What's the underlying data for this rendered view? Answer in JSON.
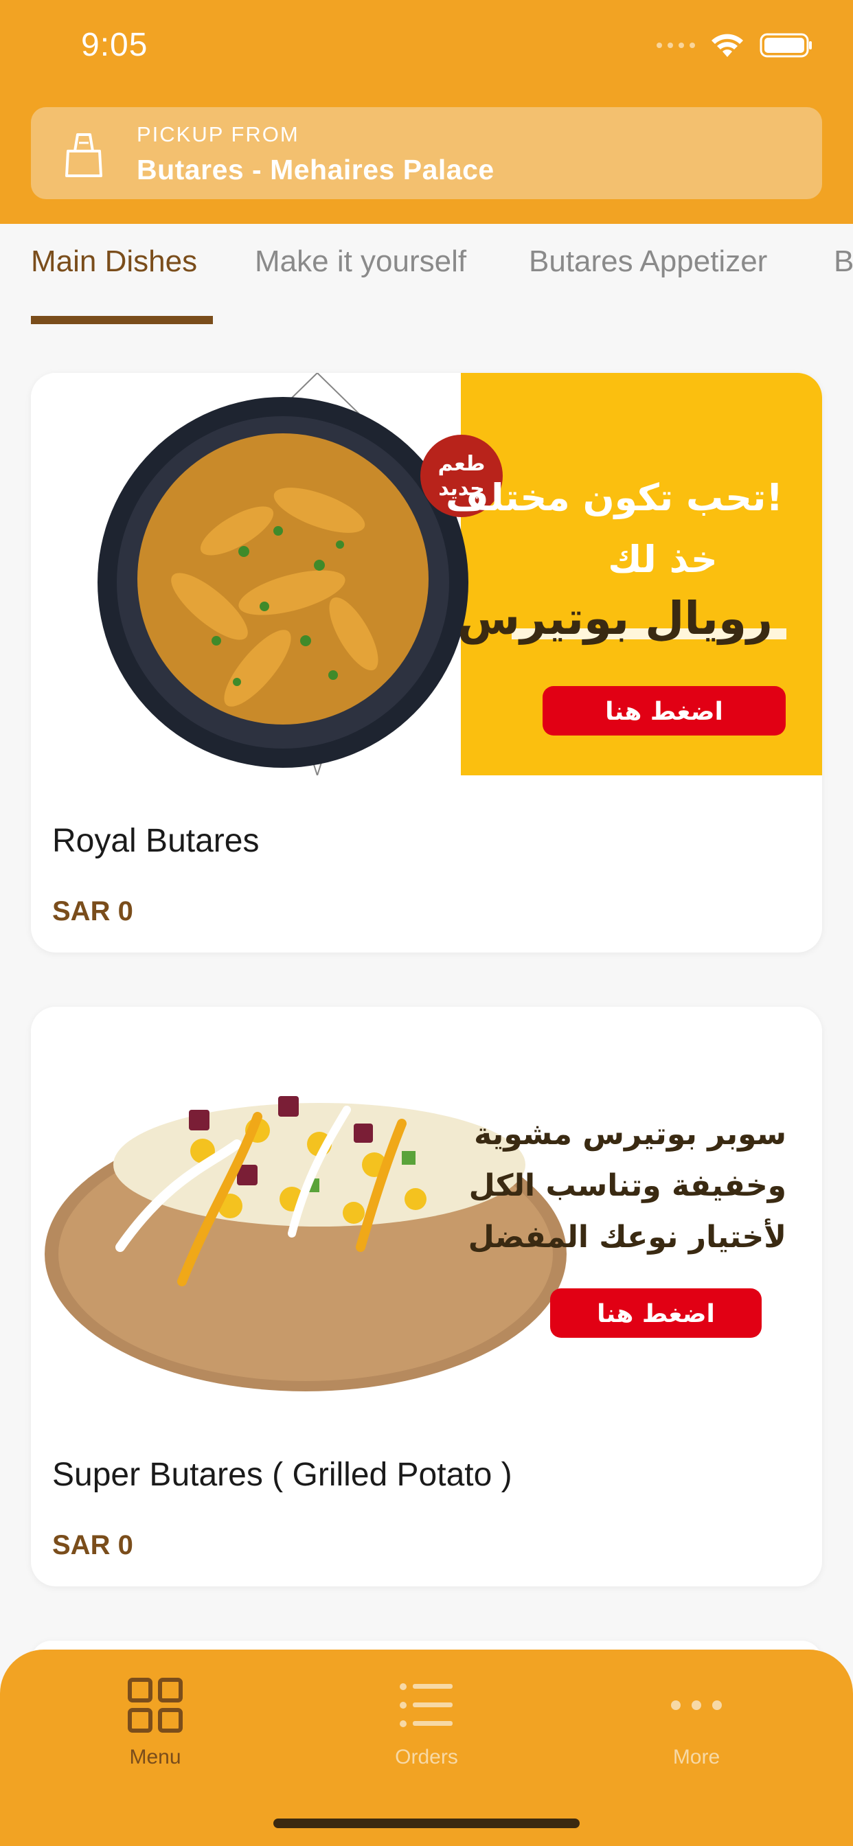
{
  "status_bar": {
    "time": "9:05"
  },
  "pickup": {
    "label": "PICKUP FROM",
    "location": "Butares - Mehaires Palace",
    "icon": "shopping-bag-icon"
  },
  "tabs": [
    {
      "label": "Main Dishes",
      "active": true
    },
    {
      "label": "Make it yourself",
      "active": false
    },
    {
      "label": "Butares Appetizer",
      "active": false
    },
    {
      "label": "B",
      "active": false
    }
  ],
  "products": [
    {
      "name": "Royal Butares",
      "price": "SAR 0",
      "promo": {
        "badge": "طعم جديد",
        "lines": [
          "تحب تكون مختلف!",
          "خذ لك",
          "رويال بوتيرس"
        ],
        "button": "اضغط هنا"
      }
    },
    {
      "name": "Super Butares ( Grilled Potato )",
      "price": "SAR 0",
      "promo": {
        "lines": [
          "سوبر بوتيرس مشوية",
          "وخفيفة وتناسب الكل",
          "لأختيار نوعك المفضل"
        ],
        "button": "اضغط هنا"
      }
    }
  ],
  "bottom_nav": [
    {
      "label": "Menu",
      "icon": "grid-icon",
      "active": true
    },
    {
      "label": "Orders",
      "icon": "list-icon",
      "active": false
    },
    {
      "label": "More",
      "icon": "more-dots-icon",
      "active": false
    }
  ],
  "colors": {
    "header": "#f2a323",
    "accent_brown": "#7a4d1b",
    "promo_yellow": "#fbbf0f",
    "promo_button": "#e10014"
  }
}
